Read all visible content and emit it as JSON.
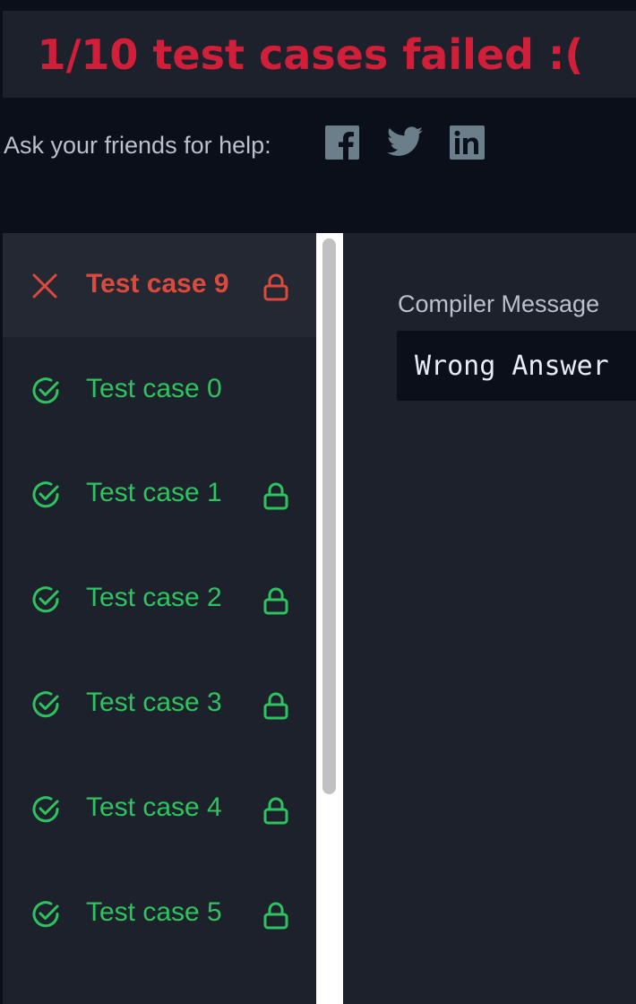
{
  "banner": {
    "text": "1/10 test cases failed :(",
    "color": "#d11f3a"
  },
  "share": {
    "label": "Ask your friends for help:",
    "icons": [
      "facebook-icon",
      "twitter-icon",
      "linkedin-icon"
    ]
  },
  "test_cases": [
    {
      "label": "Test case 9",
      "status": "failed",
      "locked": true,
      "active": true
    },
    {
      "label": "Test case 0",
      "status": "passed",
      "locked": false,
      "active": false
    },
    {
      "label": "Test case 1",
      "status": "passed",
      "locked": true,
      "active": false
    },
    {
      "label": "Test case 2",
      "status": "passed",
      "locked": true,
      "active": false
    },
    {
      "label": "Test case 3",
      "status": "passed",
      "locked": true,
      "active": false
    },
    {
      "label": "Test case 4",
      "status": "passed",
      "locked": true,
      "active": false
    },
    {
      "label": "Test case 5",
      "status": "passed",
      "locked": true,
      "active": false
    }
  ],
  "compiler": {
    "label": "Compiler Message",
    "message": "Wrong Answer"
  },
  "colors": {
    "failed": "#dc4a3d",
    "passed": "#2dc45f",
    "panel": "#1c212b",
    "page": "#0a0f1a"
  }
}
